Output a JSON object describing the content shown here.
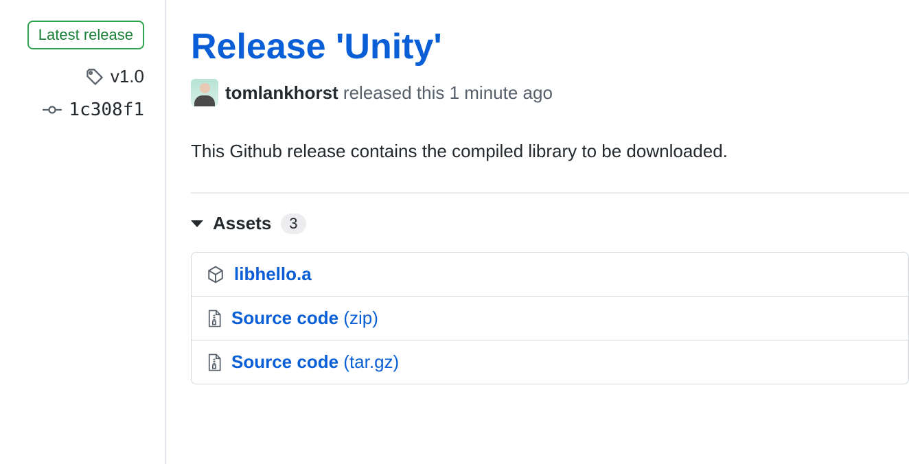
{
  "sidebar": {
    "latest_label": "Latest release",
    "tag": "v1.0",
    "commit": "1c308f1"
  },
  "release": {
    "title": "Release 'Unity'",
    "author": "tomlankhorst",
    "released_text": "released this",
    "time_ago": "1 minute ago",
    "description": "This Github release contains the compiled library to be downloaded."
  },
  "assets": {
    "label": "Assets",
    "count": "3",
    "items": [
      {
        "name": "libhello.a",
        "ext": "",
        "type": "package"
      },
      {
        "name": "Source code",
        "ext": "(zip)",
        "type": "zip"
      },
      {
        "name": "Source code",
        "ext": "(tar.gz)",
        "type": "zip"
      }
    ]
  }
}
